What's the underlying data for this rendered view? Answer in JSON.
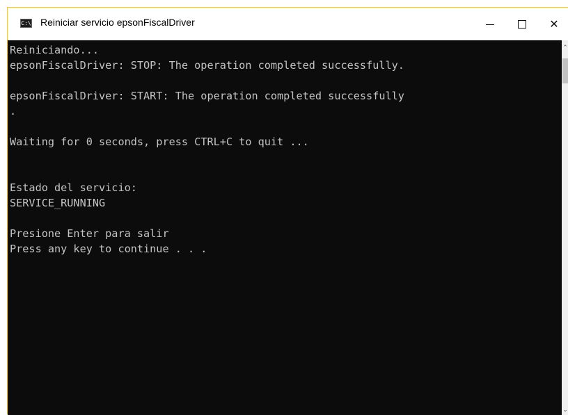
{
  "window": {
    "title": "Reiniciar servicio epsonFiscalDriver",
    "icon": "console-icon",
    "icon_glyph": "C:\\",
    "accent_color": "#e8c75a"
  },
  "controls": {
    "minimize_glyph": "",
    "maximize_glyph": "",
    "close_glyph": "✕"
  },
  "console": {
    "background": "#0c0c0c",
    "foreground": "#c4c4c4",
    "lines": [
      "Reiniciando...",
      "epsonFiscalDriver: STOP: The operation completed successfully.",
      "",
      "epsonFiscalDriver: START: The operation completed successfully",
      ".",
      "",
      "Waiting for 0 seconds, press CTRL+C to quit ...",
      "",
      "",
      "Estado del servicio:",
      "SERVICE_RUNNING",
      "",
      "Presione Enter para salir",
      "Press any key to continue . . ."
    ]
  },
  "scrollbar": {
    "up_glyph": "⌃",
    "down_glyph": "⌄"
  }
}
